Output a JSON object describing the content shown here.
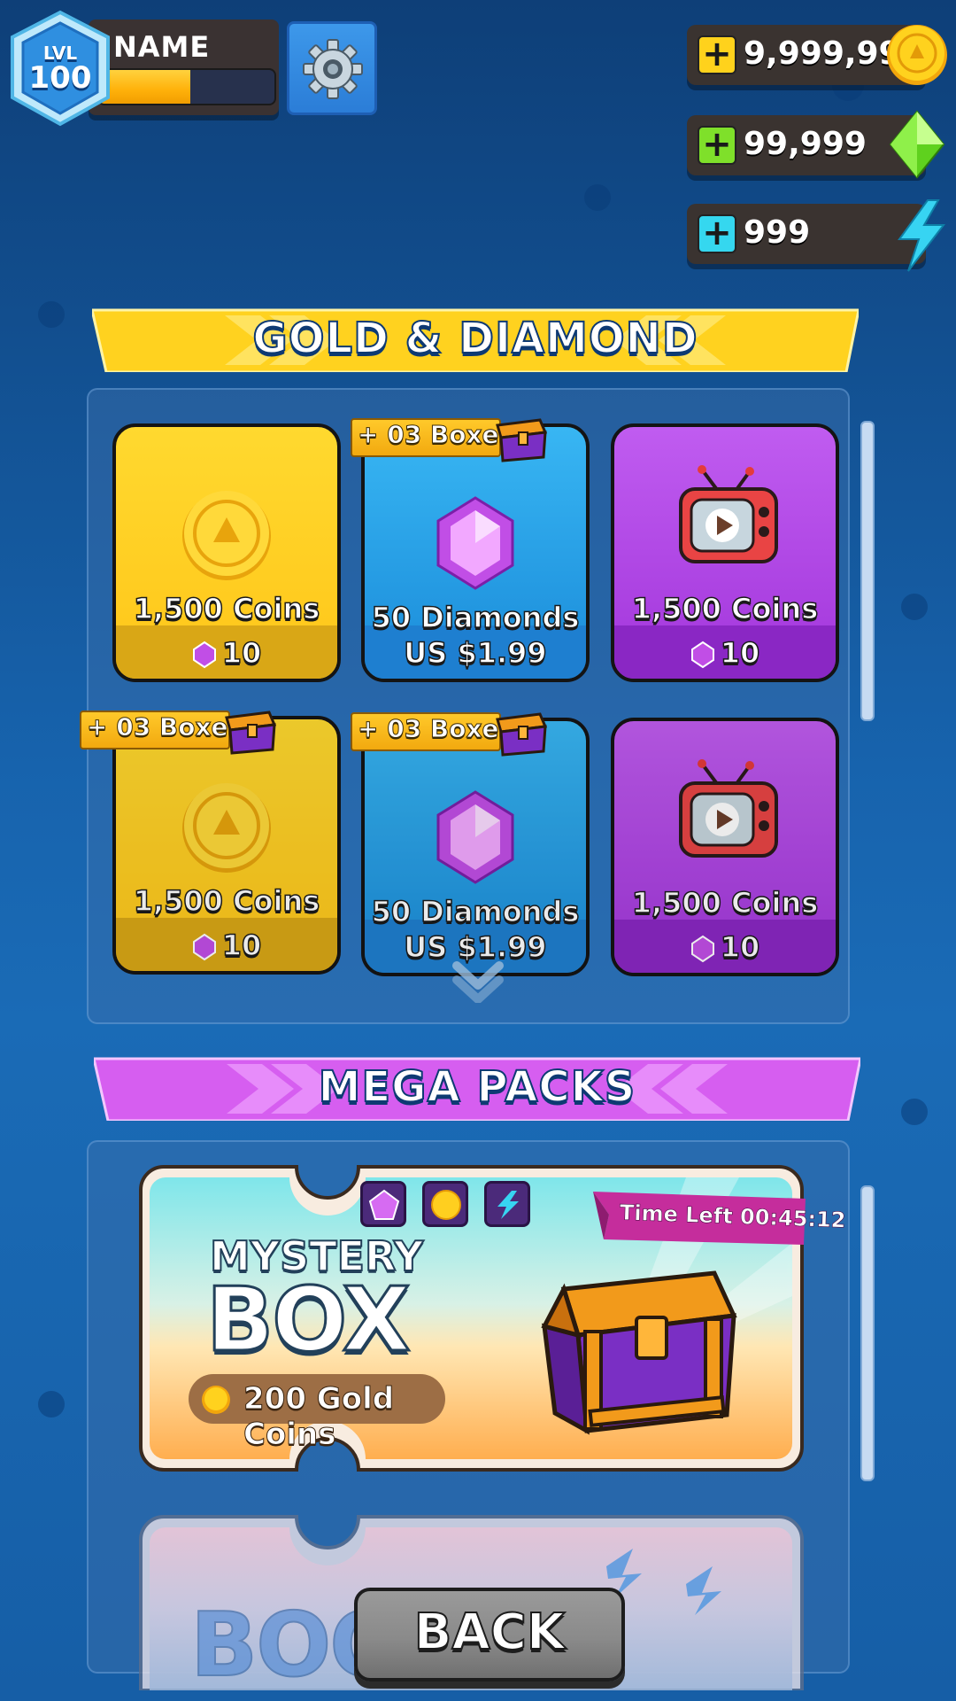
{
  "player": {
    "level_label": "LVL",
    "level": "100",
    "name": "NAME",
    "xp_progress": 0.52
  },
  "currencies": {
    "coins": "9,999,999",
    "diamonds": "99,999",
    "energy": "999"
  },
  "gold_diamond": {
    "title": "GOLD & DIAMOND",
    "cards": [
      {
        "label": "1,500 Coins",
        "price": "10"
      },
      {
        "label": "50 Diamonds",
        "price": "US $1.99",
        "bonus": "+ 03 Boxes"
      },
      {
        "label": "1,500 Coins",
        "price": "10"
      },
      {
        "label": "1,500 Coins",
        "price": "10",
        "bonus": "+ 03 Boxes"
      },
      {
        "label": "50 Diamonds",
        "price": "US $1.99",
        "bonus": "+ 03 Boxes"
      },
      {
        "label": "1,500 Coins",
        "price": "10"
      }
    ]
  },
  "mega_packs": {
    "title": "MEGA PACKS",
    "mystery": {
      "line1": "MYSTERY",
      "line2": "BOX",
      "reward": "200 Gold Coins",
      "time_left": "Time Left 00:45:12"
    },
    "second_pack_title": "BOO"
  },
  "back_label": "BACK",
  "colors": {
    "background": "#1763ad",
    "gold": "#ffc619",
    "blue": "#1a8bd9",
    "purple": "#a236db",
    "ribbon_gold": "#ffd21f",
    "ribbon_pink": "#d65ef0"
  }
}
